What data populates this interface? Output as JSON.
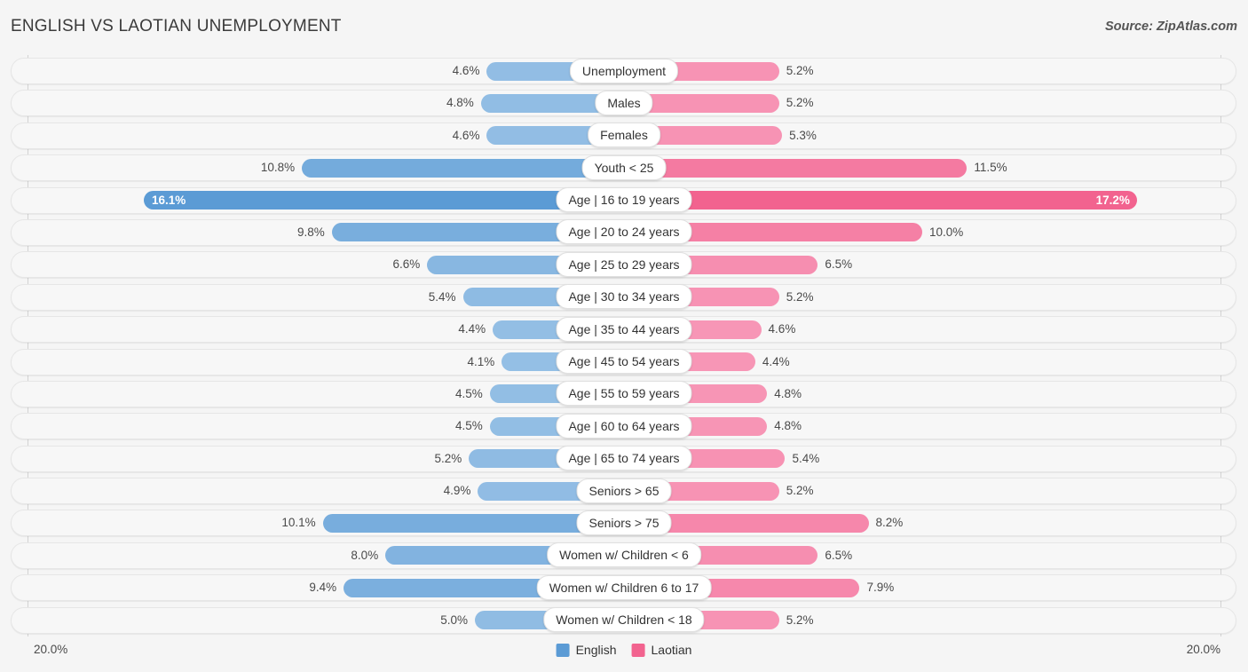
{
  "header": {
    "title": "ENGLISH VS LAOTIAN UNEMPLOYMENT",
    "source": "Source: ZipAtlas.com"
  },
  "footer": {
    "axis_min_label": "20.0%",
    "axis_max_label": "20.0%",
    "legend": [
      {
        "label": "English",
        "color": "#5B9BD5"
      },
      {
        "label": "Laotian",
        "color": "#F2638F"
      }
    ]
  },
  "colors": {
    "english_base": "#A8CBEA",
    "english_strong": "#5B9BD5",
    "laotian_base": "#F9A8C4",
    "laotian_strong": "#F2638F",
    "track": "#f7f7f7",
    "axis": "#d3d3d3",
    "page_background": "#f5f5f5"
  },
  "chart_data": {
    "type": "bar",
    "orientation": "diverging-horizontal",
    "title": "ENGLISH VS LAOTIAN UNEMPLOYMENT",
    "xlabel": "",
    "ylabel": "",
    "axis_max": 20.0,
    "axis_unit": "%",
    "grid": false,
    "legend_position": "bottom-center",
    "categories": [
      "Unemployment",
      "Males",
      "Females",
      "Youth < 25",
      "Age | 16 to 19 years",
      "Age | 20 to 24 years",
      "Age | 25 to 29 years",
      "Age | 30 to 34 years",
      "Age | 35 to 44 years",
      "Age | 45 to 54 years",
      "Age | 55 to 59 years",
      "Age | 60 to 64 years",
      "Age | 65 to 74 years",
      "Seniors > 65",
      "Seniors > 75",
      "Women w/ Children < 6",
      "Women w/ Children 6 to 17",
      "Women w/ Children < 18"
    ],
    "series": [
      {
        "name": "English",
        "side": "left",
        "values": [
          4.6,
          4.8,
          4.6,
          10.8,
          16.1,
          9.8,
          6.6,
          5.4,
          4.4,
          4.1,
          4.5,
          4.5,
          5.2,
          4.9,
          10.1,
          8.0,
          9.4,
          5.0
        ],
        "labels": [
          "4.6%",
          "4.8%",
          "4.6%",
          "10.8%",
          "16.1%",
          "9.8%",
          "6.6%",
          "5.4%",
          "4.4%",
          "4.1%",
          "4.5%",
          "4.5%",
          "5.2%",
          "4.9%",
          "10.1%",
          "8.0%",
          "9.4%",
          "5.0%"
        ]
      },
      {
        "name": "Laotian",
        "side": "right",
        "values": [
          5.2,
          5.2,
          5.3,
          11.5,
          17.2,
          10.0,
          6.5,
          5.2,
          4.6,
          4.4,
          4.8,
          4.8,
          5.4,
          5.2,
          8.2,
          6.5,
          7.9,
          5.2
        ],
        "labels": [
          "5.2%",
          "5.2%",
          "5.3%",
          "11.5%",
          "17.2%",
          "10.0%",
          "6.5%",
          "5.2%",
          "4.6%",
          "4.4%",
          "4.8%",
          "4.8%",
          "5.4%",
          "5.2%",
          "8.2%",
          "6.5%",
          "7.9%",
          "5.2%"
        ]
      }
    ],
    "highlighted_row_index": 4
  }
}
